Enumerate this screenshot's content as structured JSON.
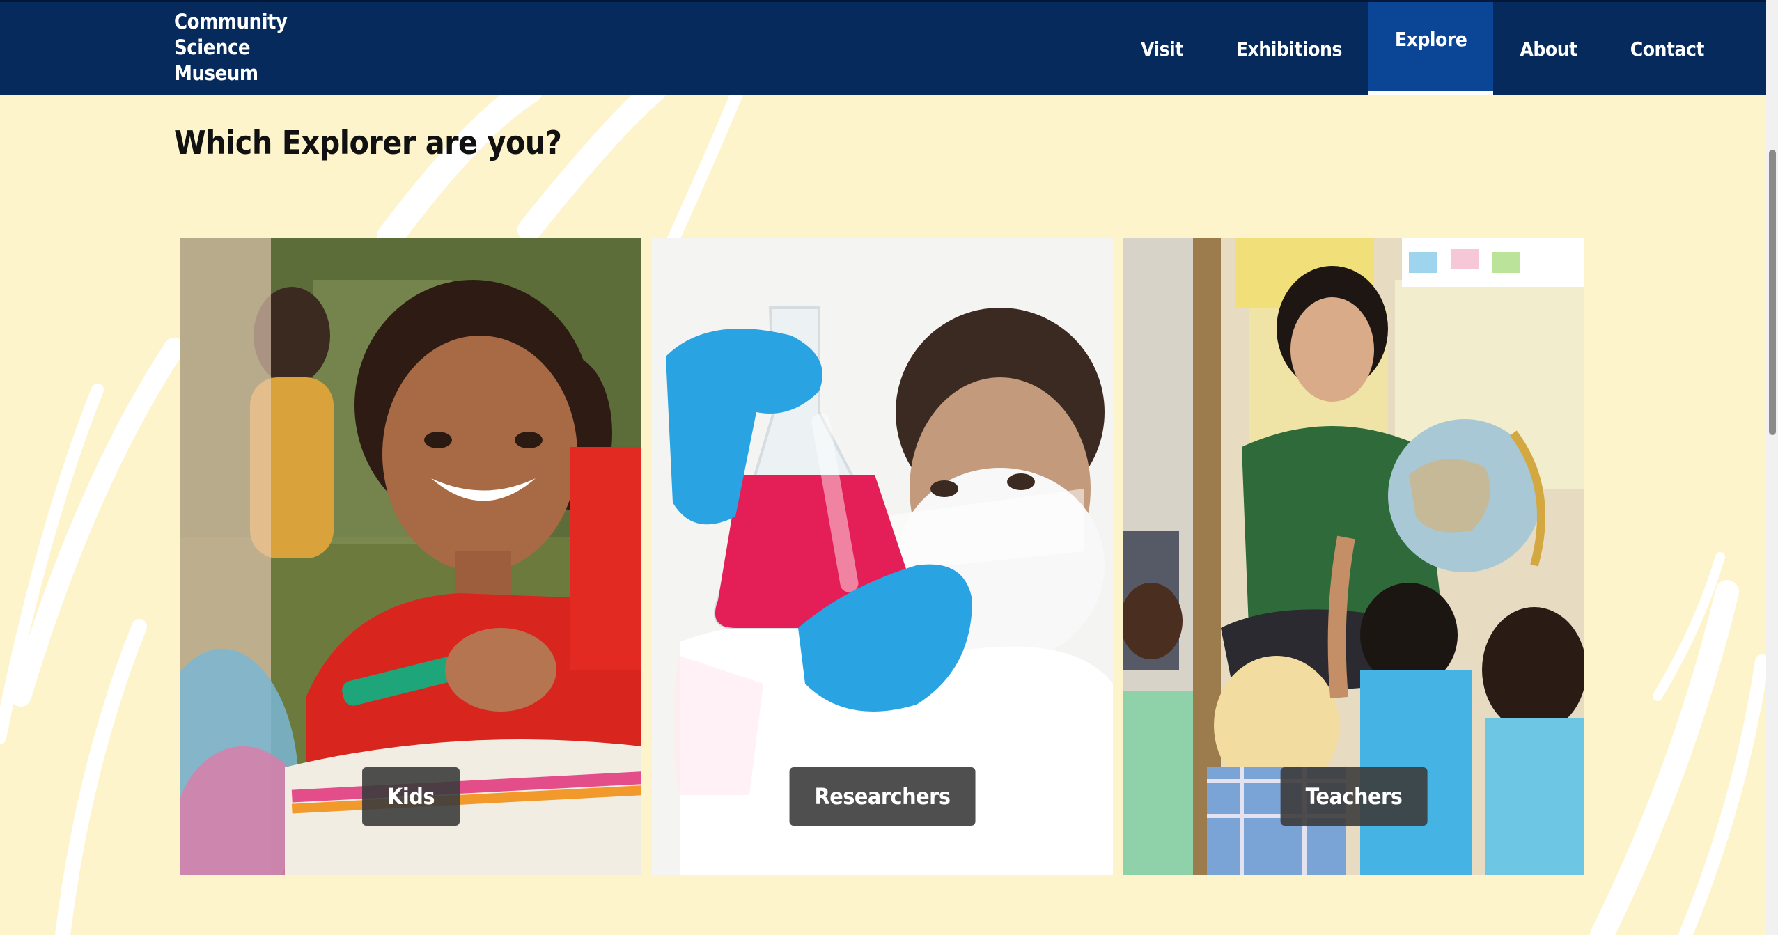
{
  "logo": {
    "lines": [
      "Community",
      "Science",
      "Museum"
    ]
  },
  "nav": {
    "items": [
      {
        "label": "Visit"
      },
      {
        "label": "Exhibitions"
      },
      {
        "label": "Explore",
        "active": true
      },
      {
        "label": "About"
      },
      {
        "label": "Contact"
      }
    ]
  },
  "main": {
    "heading": "Which Explorer are you?",
    "cards": [
      {
        "label": "Kids",
        "photo": "girl-smiling-with-marker"
      },
      {
        "label": "Researchers",
        "photo": "scientist-holding-flask"
      },
      {
        "label": "Teachers",
        "photo": "teacher-with-globe-and-children"
      }
    ]
  },
  "colors": {
    "navbar": "#072a5c",
    "nav_active": "#0b4596",
    "page_background": "#fdf4cc",
    "label_background": "#3c3c3c"
  }
}
